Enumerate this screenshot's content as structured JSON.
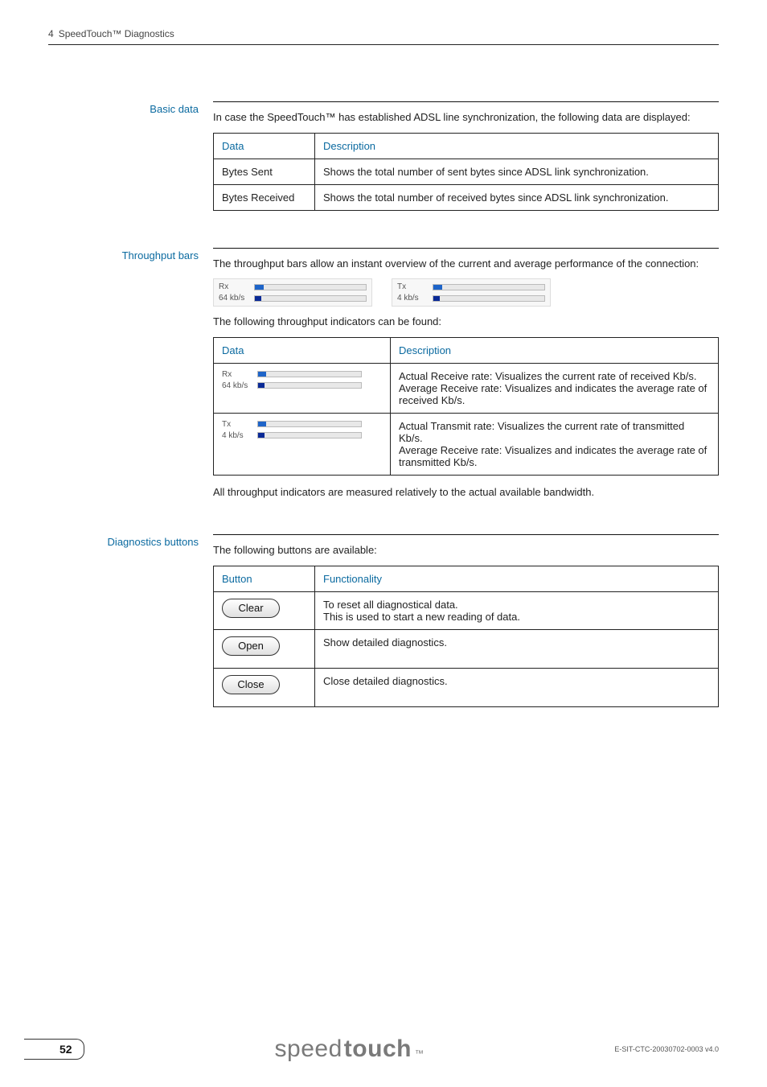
{
  "header": {
    "chapter_num": "4",
    "chapter_title": "SpeedTouch™ Diagnostics"
  },
  "basic_data": {
    "label": "Basic data",
    "intro": "In case the SpeedTouch™ has established ADSL line synchronization, the following data are displayed:",
    "col1": "Data",
    "col2": "Description",
    "rows": [
      {
        "data": "Bytes Sent",
        "desc": "Shows the total number of sent bytes since ADSL link synchronization."
      },
      {
        "data": "Bytes Received",
        "desc": "Shows the total number of received bytes since ADSL link synchronization."
      }
    ]
  },
  "throughput": {
    "label": "Throughput bars",
    "intro": "The throughput bars allow an instant overview of the current and average performance of the connection:",
    "bars": {
      "rx": {
        "label": "Rx",
        "rate_label": "64 kb/s"
      },
      "tx": {
        "label": "Tx",
        "rate_label": "4 kb/s"
      }
    },
    "mid": "The following throughput indicators can be found:",
    "col1": "Data",
    "col2": "Description",
    "rows": [
      {
        "rx": true,
        "desc": "Actual Receive rate: Visualizes the current rate of received Kb/s.\nAverage Receive rate: Visualizes and indicates the average rate of received Kb/s."
      },
      {
        "rx": false,
        "desc": "Actual Transmit rate: Visualizes the current rate of transmitted Kb/s.\nAverage Receive rate: Visualizes and indicates the average rate of transmitted Kb/s."
      }
    ],
    "note": "All throughput indicators are measured relatively to the actual available bandwidth."
  },
  "diag_buttons": {
    "label": "Diagnostics buttons",
    "intro": "The following buttons are available:",
    "col1": "Button",
    "col2": "Functionality",
    "rows": [
      {
        "btn": "Clear",
        "desc": "To reset all diagnostical data.\nThis is used to start a new reading of data."
      },
      {
        "btn": "Open",
        "desc": "Show detailed diagnostics."
      },
      {
        "btn": "Close",
        "desc": "Close detailed diagnostics."
      }
    ]
  },
  "footer": {
    "page": "52",
    "logo_light": "speed",
    "logo_bold": "touch",
    "logo_tm": "™",
    "docver": "E-SIT-CTC-20030702-0003 v4.0"
  }
}
